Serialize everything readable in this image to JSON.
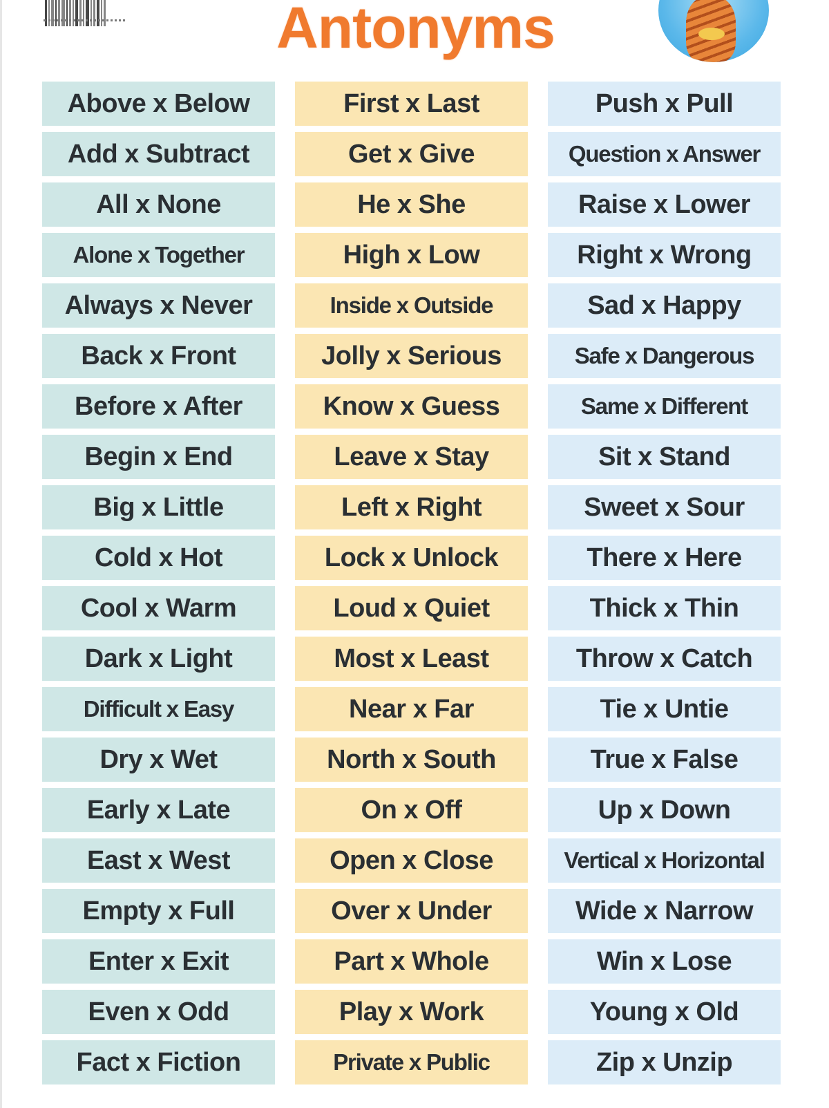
{
  "header": {
    "title": "Antonyms",
    "title_color": "#f07a2e",
    "barcode_icon": "barcode-icon",
    "mascot_icon": "tiger-mascot-icon"
  },
  "columns": [
    {
      "color": "#cfe7e6",
      "items": [
        "Above x Below",
        "Add x Subtract",
        "All x None",
        "Alone x Together",
        "Always x Never",
        "Back x Front",
        "Before x After",
        "Begin x End",
        "Big x Little",
        "Cold x Hot",
        "Cool x Warm",
        "Dark x Light",
        "Difficult x Easy",
        "Dry x Wet",
        "Early x Late",
        "East x West",
        "Empty x Full",
        "Enter x Exit",
        "Even x Odd",
        "Fact x Fiction"
      ]
    },
    {
      "color": "#fbe6b3",
      "items": [
        "First x Last",
        "Get x Give",
        "He x She",
        "High x Low",
        "Inside x Outside",
        "Jolly x Serious",
        "Know x Guess",
        "Leave x Stay",
        "Left x Right",
        "Lock x Unlock",
        "Loud x Quiet",
        "Most x Least",
        "Near x Far",
        "North x South",
        "On x Off",
        "Open x Close",
        "Over x Under",
        "Part x Whole",
        "Play x Work",
        "Private x Public"
      ]
    },
    {
      "color": "#dcecf8",
      "items": [
        "Push x Pull",
        "Question x Answer",
        "Raise x Lower",
        "Right x Wrong",
        "Sad x Happy",
        "Safe x Dangerous",
        "Same x Different",
        "Sit x Stand",
        "Sweet x Sour",
        "There x Here",
        "Thick x Thin",
        "Throw x Catch",
        "Tie x Untie",
        "True x False",
        "Up x Down",
        "Vertical x Horizontal",
        "Wide x Narrow",
        "Win x Lose",
        "Young x Old",
        "Zip x Unzip"
      ]
    }
  ]
}
